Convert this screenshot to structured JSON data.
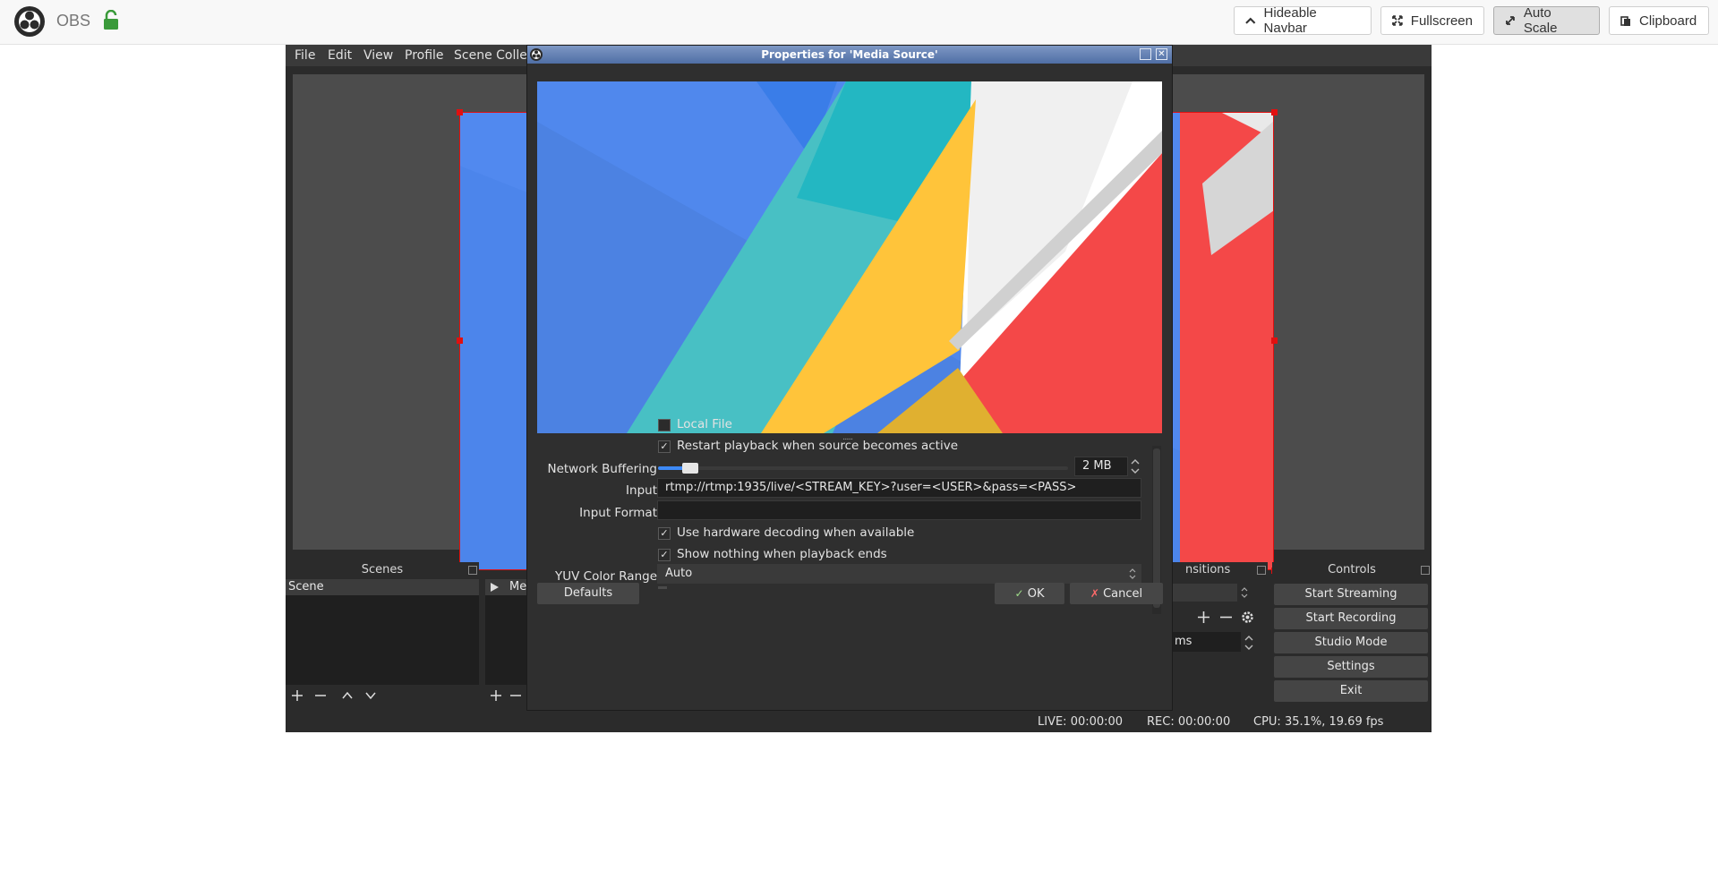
{
  "navbar": {
    "brand": "OBS",
    "buttons": [
      {
        "label": "Hideable Navbar",
        "icon": "chevron-up-icon"
      },
      {
        "label": "Fullscreen",
        "icon": "expand-icon"
      },
      {
        "label": "Auto Scale",
        "icon": "resize-icon",
        "active": true
      },
      {
        "label": "Clipboard",
        "icon": "clipboard-icon"
      }
    ]
  },
  "obs": {
    "menu": [
      "File",
      "Edit",
      "View",
      "Profile",
      "Scene Collec"
    ],
    "docks": {
      "scenes_title": "Scenes",
      "scene_items": [
        "Scene"
      ],
      "sources_first_item": "Me",
      "transitions_title": "nsitions",
      "duration_unit": "ms",
      "controls_title": "Controls"
    },
    "controls": [
      "Start Streaming",
      "Start Recording",
      "Studio Mode",
      "Settings",
      "Exit"
    ],
    "status": {
      "live": "LIVE: 00:00:00",
      "rec": "REC: 00:00:00",
      "cpu": "CPU: 35.1%, 19.69 fps"
    }
  },
  "dialog": {
    "title": "Properties for 'Media Source'",
    "local_file": {
      "label": "Local File",
      "checked": false
    },
    "restart": {
      "label": "Restart playback when source becomes active",
      "checked": true
    },
    "network_buffering": {
      "label": "Network Buffering",
      "value": "2 MB",
      "level": 0.06
    },
    "input": {
      "label": "Input",
      "value": "rtmp://rtmp:1935/live/<STREAM_KEY>?user=<USER>&pass=<PASS>"
    },
    "input_format": {
      "label": "Input Format",
      "value": ""
    },
    "hw_decoding": {
      "label": "Use hardware decoding when available",
      "checked": true
    },
    "show_nothing": {
      "label": "Show nothing when playback ends",
      "checked": true
    },
    "yuv": {
      "label": "YUV Color Range",
      "value": "Auto"
    },
    "buttons": {
      "defaults": "Defaults",
      "ok": "OK",
      "cancel": "Cancel"
    }
  },
  "colors": {
    "accent_blue": "#3d8af7",
    "canvas_red": "#f44848",
    "obs_bg": "#2b2b2b"
  }
}
